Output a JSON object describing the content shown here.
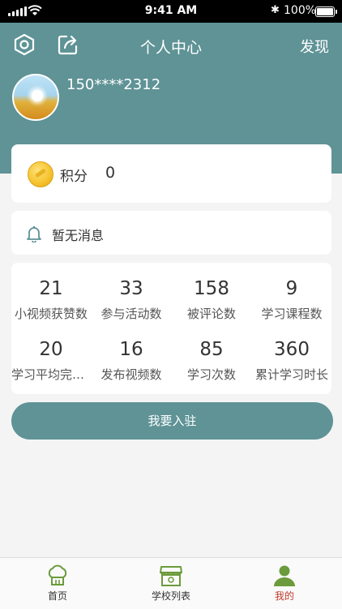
{
  "status_bar": {
    "time": "9:41 AM",
    "battery": "100%"
  },
  "nav": {
    "title": "个人中心",
    "discover_label": "发现",
    "icons": [
      "settings-icon",
      "share-icon"
    ]
  },
  "profile": {
    "username": "150****2312"
  },
  "points": {
    "label": "积分",
    "value": "0"
  },
  "messages": {
    "text": "暂无消息"
  },
  "stats": [
    {
      "value": "21",
      "label": "小视频获赞数"
    },
    {
      "value": "33",
      "label": "参与活动数"
    },
    {
      "value": "158",
      "label": "被评论数"
    },
    {
      "value": "9",
      "label": "学习课程数"
    },
    {
      "value": "20",
      "label": "学习平均完成度"
    },
    {
      "value": "16",
      "label": "发布视频数"
    },
    {
      "value": "85",
      "label": "学习次数"
    },
    {
      "value": "360",
      "label": "累计学习时长"
    }
  ],
  "join_button": "我要入驻",
  "tabbar": {
    "items": [
      {
        "label": "首页",
        "icon": "chef-hat-icon"
      },
      {
        "label": "学校列表",
        "icon": "school-icon"
      },
      {
        "label": "我的",
        "icon": "user-icon",
        "active": true
      }
    ],
    "active_color": "#c0392b"
  },
  "colors": {
    "theme": "#5f9396",
    "icon_green": "#6b9b3c"
  }
}
